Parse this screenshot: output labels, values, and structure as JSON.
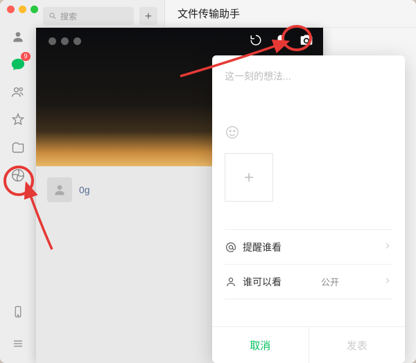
{
  "header": {
    "title": "文件传输助手"
  },
  "search": {
    "placeholder": "搜索"
  },
  "sidebar": {
    "chat_badge": "9",
    "icons": [
      "chat",
      "contacts",
      "favorites",
      "files",
      "moments"
    ]
  },
  "moments": {
    "feed": [
      {
        "name": "0g"
      }
    ]
  },
  "composer": {
    "placeholder": "这一刻的想法...",
    "mention_label": "提醒谁看",
    "visibility_label": "谁可以看",
    "visibility_value": "公开",
    "cancel_label": "取消",
    "publish_label": "发表"
  }
}
